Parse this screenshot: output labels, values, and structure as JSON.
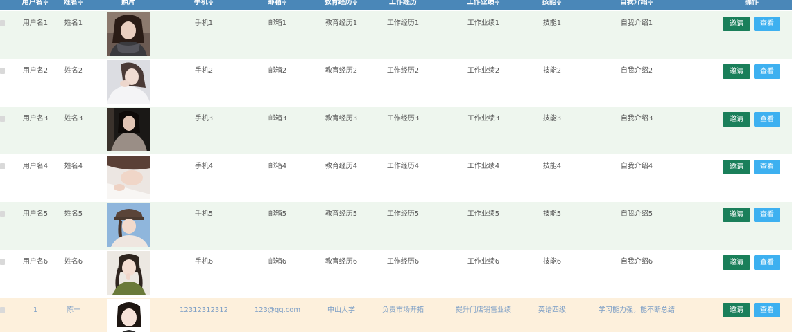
{
  "header": {
    "columns": [
      "用户名≑",
      "姓名≑",
      "照片",
      "手机≑",
      "邮箱≑",
      "教育经历≑",
      "工作经历",
      "工作业绩≑",
      "技能≑",
      "自我介绍≑",
      "操作"
    ]
  },
  "rows": [
    {
      "username": "用户名1",
      "name": "姓名1",
      "phone": "手机1",
      "email": "邮箱1",
      "education": "教育经历1",
      "work": "工作经历1",
      "achievement": "工作业绩1",
      "skill": "技能1",
      "intro": "自我介绍1",
      "invite": "邀请",
      "view": "查看",
      "photo": "portrait-scarf"
    },
    {
      "username": "用户名2",
      "name": "姓名2",
      "phone": "手机2",
      "email": "邮箱2",
      "education": "教育经历2",
      "work": "工作经历2",
      "achievement": "工作业绩2",
      "skill": "技能2",
      "intro": "自我介绍2",
      "invite": "邀请",
      "view": "查看",
      "photo": "portrait-white-sweater"
    },
    {
      "username": "用户名3",
      "name": "姓名3",
      "phone": "手机3",
      "email": "邮箱3",
      "education": "教育经历3",
      "work": "工作经历3",
      "achievement": "工作业绩3",
      "skill": "技能3",
      "intro": "自我介绍3",
      "invite": "邀请",
      "view": "查看",
      "photo": "portrait-dark-bg"
    },
    {
      "username": "用户名4",
      "name": "姓名4",
      "phone": "手机4",
      "email": "邮箱4",
      "education": "教育经历4",
      "work": "工作经历4",
      "achievement": "工作业绩4",
      "skill": "技能4",
      "intro": "自我介绍4",
      "invite": "邀请",
      "view": "查看",
      "photo": "portrait-lying"
    },
    {
      "username": "用户名5",
      "name": "姓名5",
      "phone": "手机5",
      "email": "邮箱5",
      "education": "教育经历5",
      "work": "工作经历5",
      "achievement": "工作业绩5",
      "skill": "技能5",
      "intro": "自我介绍5",
      "invite": "邀请",
      "view": "查看",
      "photo": "portrait-cap"
    },
    {
      "username": "用户名6",
      "name": "姓名6",
      "phone": "手机6",
      "email": "邮箱6",
      "education": "教育经历6",
      "work": "工作经历6",
      "achievement": "工作业绩6",
      "skill": "技能6",
      "intro": "自我介绍6",
      "invite": "邀请",
      "view": "查看",
      "photo": "portrait-braids"
    },
    {
      "username": "1",
      "name": "陈一",
      "phone": "12312312312",
      "email": "123@qq.com",
      "education": "中山大学",
      "work": "负责市场开拓",
      "achievement": "提升门店销售业绩",
      "skill": "英语四级",
      "intro": "学习能力强，能不断总结",
      "invite": "邀请",
      "view": "查看",
      "photo": "portrait-id"
    }
  ],
  "colors": {
    "header_bg": "#4a87b8",
    "row_even": "#eef6ee",
    "row_special": "#fdf0dc",
    "invite_btn": "#1a7f5a",
    "view_btn": "#3db0f0"
  }
}
